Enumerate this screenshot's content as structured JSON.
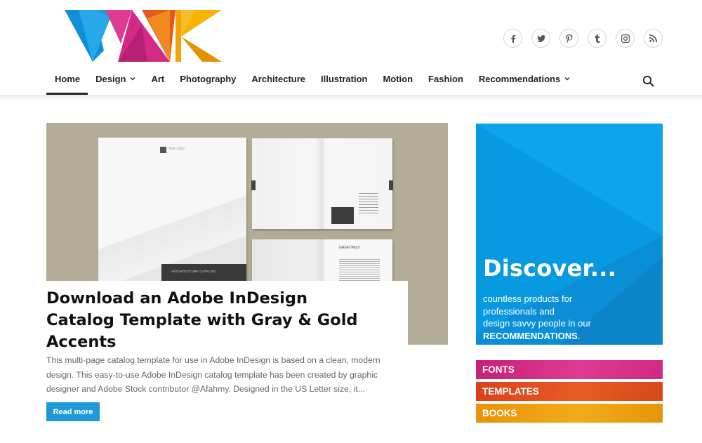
{
  "site": {
    "logo_alt": "WdC",
    "social_links": [
      {
        "name": "facebook",
        "glyph": "f"
      },
      {
        "name": "twitter",
        "glyph": "twitter"
      },
      {
        "name": "pinterest",
        "glyph": "p"
      },
      {
        "name": "tumblr",
        "glyph": "t"
      },
      {
        "name": "instagram",
        "glyph": "instagram"
      },
      {
        "name": "rss",
        "glyph": "rss"
      }
    ]
  },
  "nav": {
    "items": [
      {
        "label": "Home",
        "active": true,
        "dropdown": false
      },
      {
        "label": "Design",
        "active": false,
        "dropdown": true
      },
      {
        "label": "Art",
        "active": false,
        "dropdown": false
      },
      {
        "label": "Photography",
        "active": false,
        "dropdown": false
      },
      {
        "label": "Architecture",
        "active": false,
        "dropdown": false
      },
      {
        "label": "Illustration",
        "active": false,
        "dropdown": false
      },
      {
        "label": "Motion",
        "active": false,
        "dropdown": false
      },
      {
        "label": "Fashion",
        "active": false,
        "dropdown": false
      },
      {
        "label": "Recommendations",
        "active": false,
        "dropdown": true
      }
    ]
  },
  "featured": {
    "image_text": {
      "logo": "Your Logo",
      "cover_label": "ARCHITECTURE CATALOG",
      "spread_heading": "GREETINGS"
    },
    "title": "Download an Adobe InDesign Catalog Template with Gray & Gold Accents",
    "excerpt": "This multi-page catalog template for use in Adobe InDesign is based on a clean, modern design. This easy-to-use Adobe InDesign catalog template has been created by graphic designer and Adobe Stock contributor @Afahmy. Designed in the US Letter size, it...",
    "read_more": "Read more"
  },
  "sidebar": {
    "promo": {
      "title": "Discover...",
      "line1": "countless products for",
      "line2": "professionals and",
      "line3": "design savvy people in our",
      "line4": "RECOMMENDATIONS",
      "line4_suffix": "."
    },
    "categories": [
      {
        "label": "FONTS",
        "color": "#d0287f"
      },
      {
        "label": "TEMPLATES",
        "color": "#e04a1f"
      },
      {
        "label": "BOOKS",
        "color": "#ec9c0a"
      }
    ]
  },
  "colors": {
    "accent_blue": "#1e9ad6",
    "promo_blue": "#0a99e0",
    "hero_bg": "#b3ad97"
  }
}
